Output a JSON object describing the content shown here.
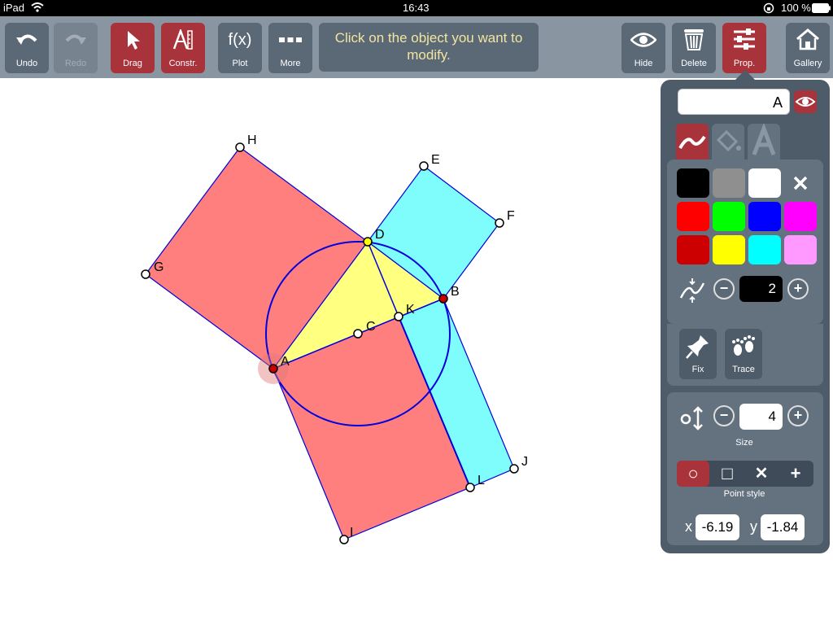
{
  "status_bar": {
    "device": "iPad",
    "time": "16:43",
    "battery": "100 %"
  },
  "toolbar": {
    "undo": "Undo",
    "redo": "Redo",
    "drag": "Drag",
    "constr": "Constr.",
    "plot": "Plot",
    "plot_symbol": "f(x)",
    "more": "More",
    "message": "Click on the object you want to modify.",
    "hide": "Hide",
    "delete": "Delete",
    "prop": "Prop.",
    "gallery": "Gallery"
  },
  "geometry": {
    "labels": {
      "H": "H",
      "E": "E",
      "F": "F",
      "G": "G",
      "D": "D",
      "B": "B",
      "K": "K",
      "C": "C",
      "A": "A",
      "J": "J",
      "L": "L",
      "I": "I"
    },
    "colors": {
      "red_fill": "#ff7f7f",
      "cyan_fill": "#7ffcfc",
      "yellow_fill": "#ffff80",
      "stroke": "#0000dd"
    }
  },
  "panel": {
    "object_name": "A",
    "colors": [
      "#000000",
      "#8f8f8f",
      "#ffffff",
      "#ff0000",
      "#00ff00",
      "#0000ff",
      "#ff00ff",
      "#cc0000",
      "#ffff00",
      "#00ffff",
      "#ff99ff"
    ],
    "line_width": "2",
    "fix": "Fix",
    "trace": "Trace",
    "size_value": "4",
    "size_label": "Size",
    "point_style_label": "Point style",
    "point_style_symbols": {
      "circle": "○",
      "square": "□",
      "cross": "✕",
      "plus": "+"
    },
    "x_label": "x",
    "x_value": "-6.19",
    "y_label": "y",
    "y_value": "-1.84"
  }
}
